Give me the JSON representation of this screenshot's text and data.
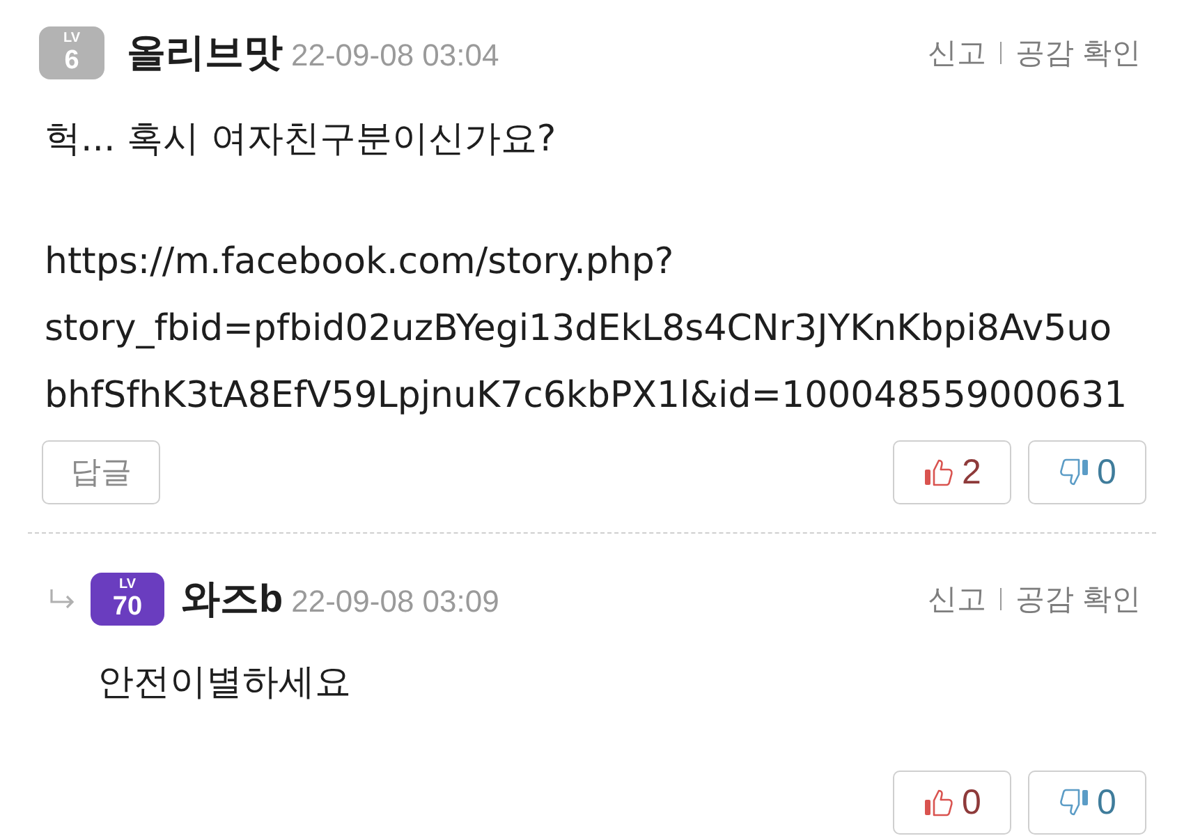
{
  "comments": [
    {
      "reply": false,
      "badge": {
        "label": "LV",
        "value": "6",
        "color": "#b3b3b3"
      },
      "author": "올리브맛",
      "date": "22-09-08 03:04",
      "actions": [
        "신고",
        "공감 확인"
      ],
      "paragraphs": [
        "헉... 혹시 여자친구분이신가요?",
        "https://m.facebook.com/story.php?\nstory_fbid=pfbid02uzBYegi13dEkL8s4CNr3JYKnKbpi8Av5uo\nbhfSfhK3tA8EfV59LpjnuK7c6kbPX1l&id=100048559000631"
      ],
      "reply_button": "답글",
      "likes": "2",
      "dislikes": "0"
    },
    {
      "reply": true,
      "badge": {
        "label": "LV",
        "value": "70",
        "color": "#6a3dbf"
      },
      "author": "와즈b",
      "date": "22-09-08 03:09",
      "actions": [
        "신고",
        "공감 확인"
      ],
      "paragraphs": [
        "안전이별하세요"
      ],
      "likes": "0",
      "dislikes": "0"
    }
  ]
}
